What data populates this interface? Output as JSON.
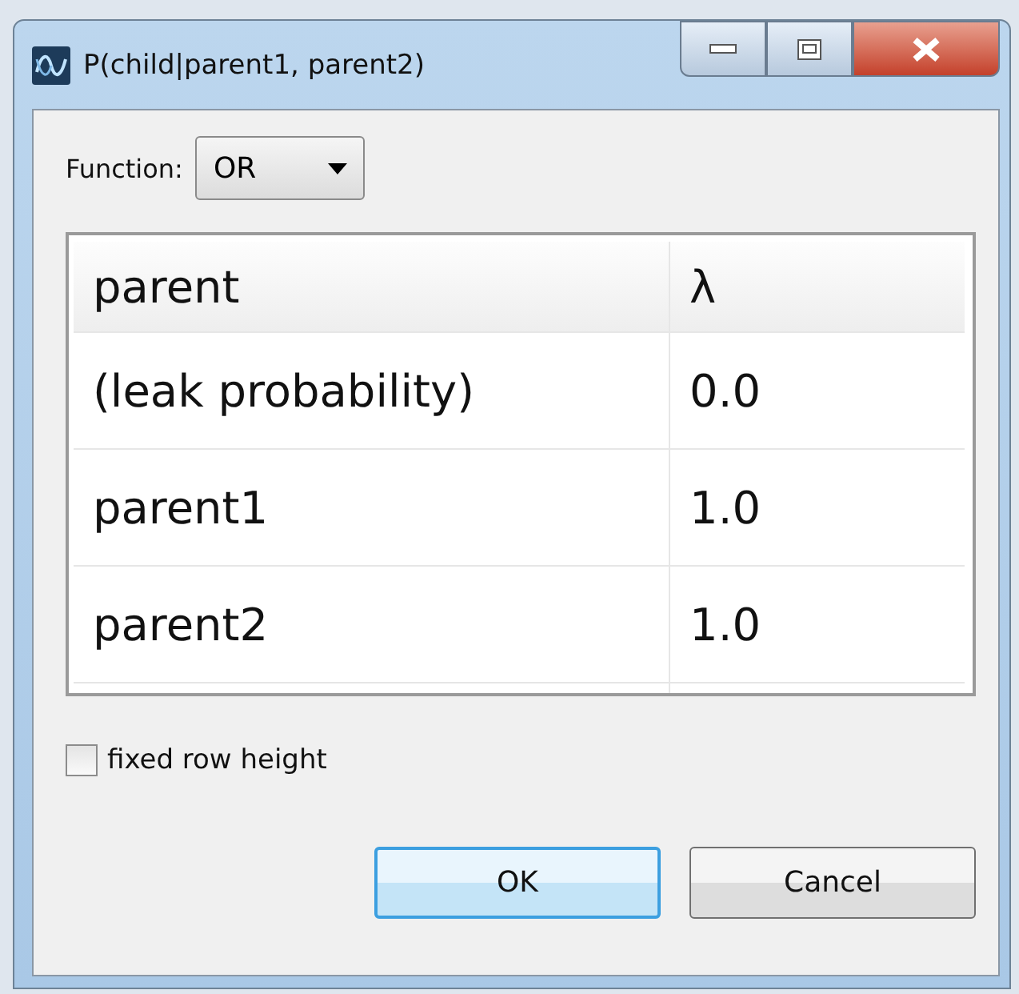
{
  "window": {
    "title": "P(child|parent1, parent2)"
  },
  "function": {
    "label": "Function:",
    "value": "OR"
  },
  "table": {
    "columns": [
      "parent",
      "λ"
    ],
    "rows": [
      [
        "(leak probability)",
        "0.0"
      ],
      [
        "parent1",
        "1.0"
      ],
      [
        "parent2",
        "1.0"
      ]
    ]
  },
  "fixed_row_height": {
    "label": "fixed row height",
    "checked": false
  },
  "buttons": [
    {
      "label": "OK",
      "default": true
    },
    {
      "label": "Cancel",
      "default": false
    }
  ]
}
